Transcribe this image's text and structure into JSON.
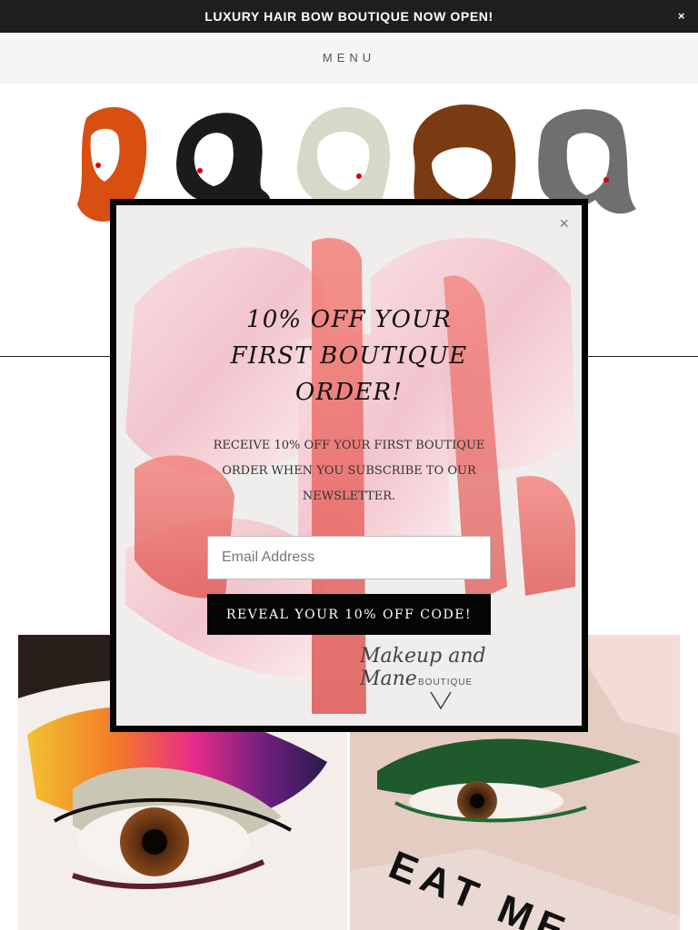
{
  "announcement": {
    "text": "LUXURY HAIR BOW BOUTIQUE NOW OPEN!",
    "close": "×"
  },
  "nav": {
    "menu_label": "MENU"
  },
  "banner": {
    "heads": [
      {
        "name": "red-hair",
        "color": "#d94f12"
      },
      {
        "name": "black-hair",
        "color": "#1b1b1b"
      },
      {
        "name": "blonde-hair",
        "color": "#d8d8c8"
      },
      {
        "name": "curly-brown-hair",
        "color": "#7a3a12"
      },
      {
        "name": "grey-hair",
        "color": "#6f6f6f"
      }
    ]
  },
  "popup": {
    "close": "×",
    "title_lines": [
      "10% OFF YOUR",
      "FIRST BOUTIQUE",
      "ORDER!"
    ],
    "body_lines": [
      "RECEIVE 10% OFF YOUR FIRST BOUTIQUE",
      "ORDER WHEN YOU SUBSCRIBE TO OUR",
      "NEWSLETTER."
    ],
    "email_placeholder": "Email Address",
    "submit_label": "REVEAL YOUR 10% OFF CODE!",
    "logo_text": "Makeup and Mane",
    "logo_subtext": "BOUTIQUE"
  },
  "tiles": {
    "right_card_text": "EAT ME"
  },
  "colors": {
    "announcement_bg": "#1e1e1e",
    "modal_border": "#050505",
    "button_bg": "#050505"
  }
}
